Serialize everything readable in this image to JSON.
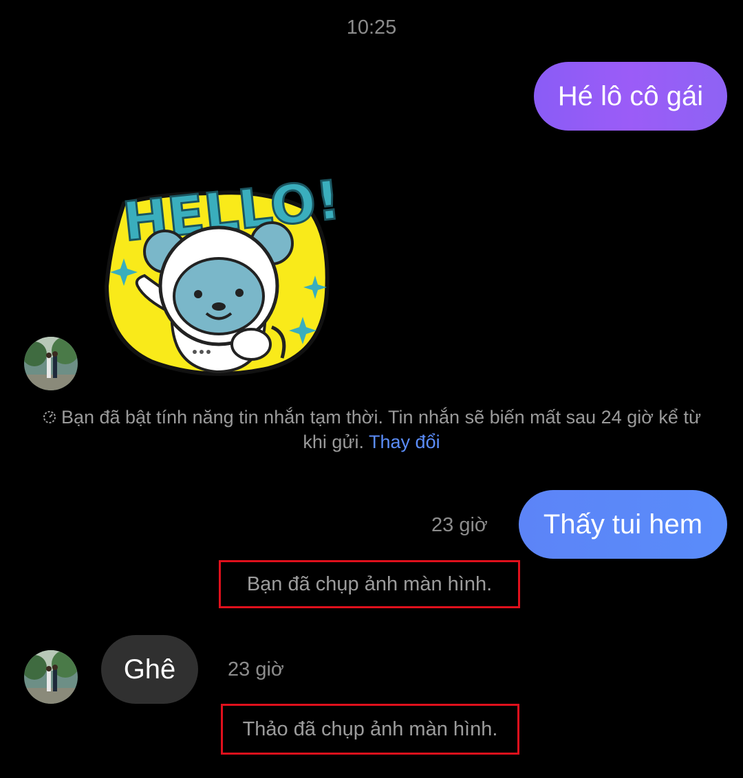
{
  "conversation": {
    "top_timestamp": "10:25",
    "messages": [
      {
        "direction": "outgoing",
        "text": "Hé lô cô gái",
        "color": "#8f5ff6"
      },
      {
        "direction": "incoming",
        "type": "sticker",
        "sticker_text": "HELLO!"
      },
      {
        "direction": "outgoing",
        "text": "Thấy tui hem",
        "time": "23 giờ",
        "color": "#5a89f9"
      },
      {
        "direction": "incoming",
        "text": "Ghê",
        "time": "23 giờ",
        "color": "#303030"
      }
    ],
    "disappearing_notice": {
      "text": "Bạn đã bật tính năng tin nhắn tạm thời. Tin nhắn sẽ biến mất sau 24 giờ kể từ khi gửi.",
      "link": "Thay đổi",
      "icon": "timer-icon"
    },
    "events": [
      {
        "text": "Bạn đã chụp ảnh màn hình."
      },
      {
        "text": "Thảo đã chụp ảnh màn hình."
      }
    ]
  },
  "colors": {
    "background": "#000000",
    "link": "#5b8dfa",
    "highlight_border": "#e0101c"
  }
}
